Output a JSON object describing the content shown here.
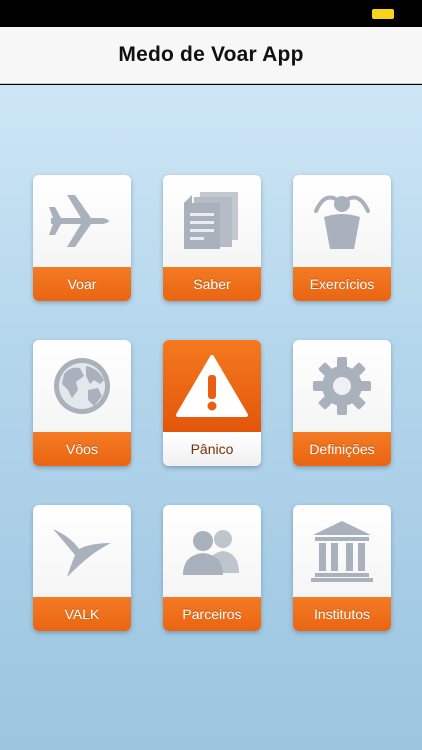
{
  "app": {
    "title": "Medo de Voar App"
  },
  "tiles": [
    {
      "label": "Voar",
      "icon": "airplane-icon"
    },
    {
      "label": "Saber",
      "icon": "documents-icon"
    },
    {
      "label": "Exercícios",
      "icon": "relaxing-person-icon"
    },
    {
      "label": "Vôos",
      "icon": "globe-icon"
    },
    {
      "label": "Pânico",
      "icon": "warning-icon"
    },
    {
      "label": "Definições",
      "icon": "gear-icon"
    },
    {
      "label": "VALK",
      "icon": "bird-icon"
    },
    {
      "label": "Parceiros",
      "icon": "people-icon"
    },
    {
      "label": "Institutos",
      "icon": "institution-icon"
    }
  ],
  "colors": {
    "accent": "#f07020",
    "icon_gray": "#a9b1bd",
    "background_top": "#cde6f5",
    "background_bottom": "#9cc5e0"
  }
}
